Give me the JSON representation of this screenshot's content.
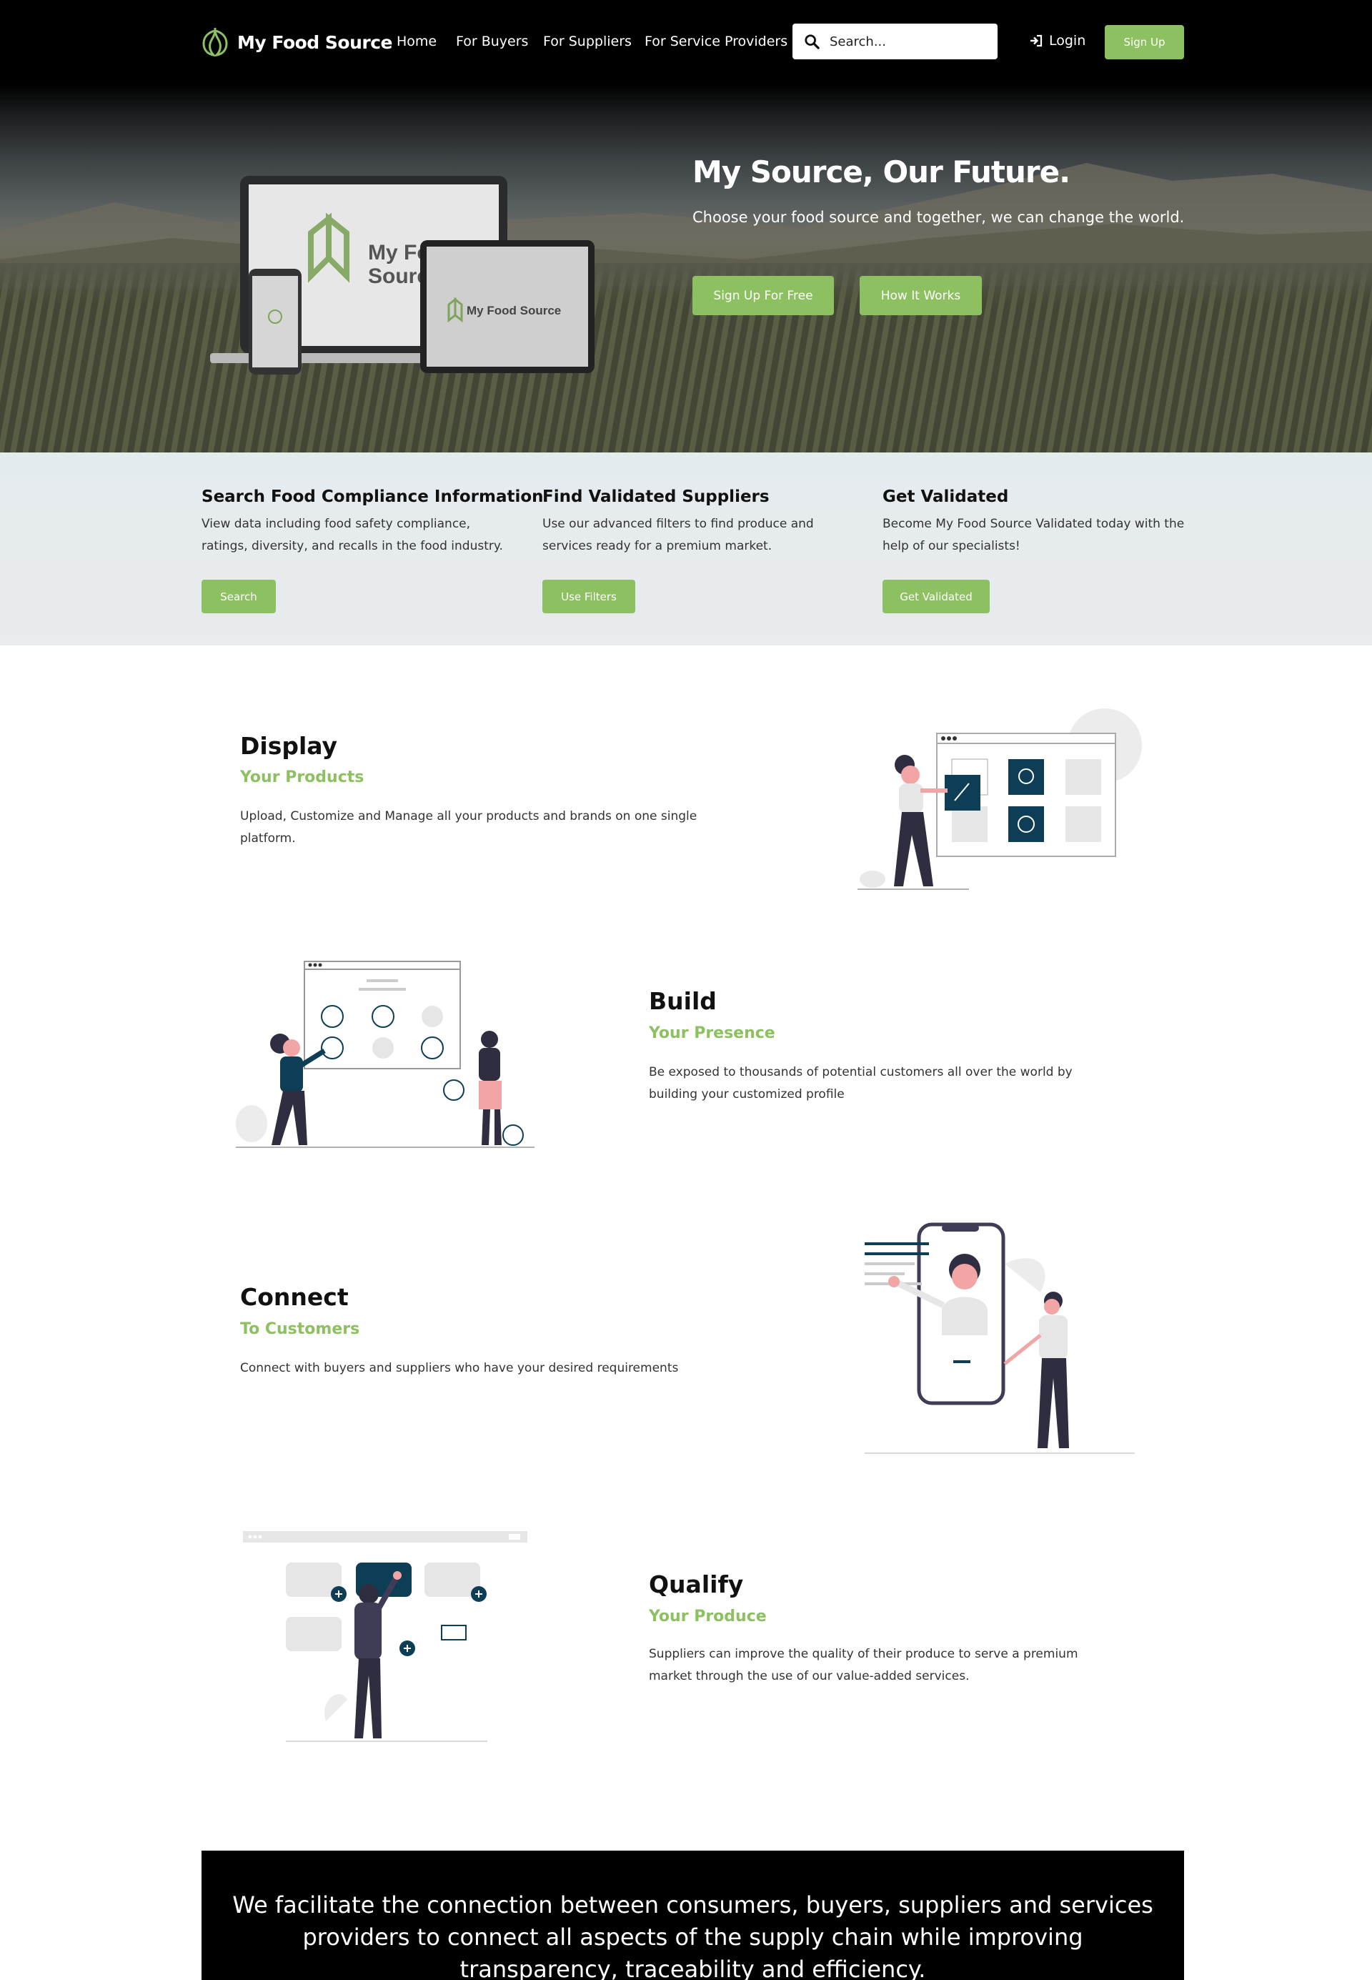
{
  "brand": {
    "name": "My Food Source",
    "accent": "#8cc060",
    "dark": "#0e3e55"
  },
  "nav": {
    "links": [
      "Home",
      "For Buyers",
      "For Suppliers",
      "For Service Providers"
    ],
    "search_placeholder": "Search...",
    "login_label": "Login",
    "signup_label": "Sign Up"
  },
  "hero": {
    "title": "My Source, Our Future.",
    "subtitle": "Choose your food source and together, we can change the world.",
    "primary_button": "Sign Up For Free",
    "secondary_button": "How It Works",
    "device_logo_line1": "My Food",
    "device_logo_line2": "Source"
  },
  "features": [
    {
      "title": "Search Food Compliance Information",
      "text": "View data including food safety compliance, ratings, diversity, and recalls in the food industry.",
      "button": "Search"
    },
    {
      "title": "Find Validated Suppliers",
      "text": "Use our advanced filters to find produce and services ready for a premium market.",
      "button": "Use Filters"
    },
    {
      "title": "Get Validated",
      "text": "Become My Food Source Validated today with the help of our specialists!",
      "button": "Get Validated"
    }
  ],
  "sections": [
    {
      "title": "Display",
      "subtitle": "Your Products",
      "text": "Upload, Customize and Manage all your products and brands on one single platform."
    },
    {
      "title": "Build",
      "subtitle": "Your Presence",
      "text": "Be exposed to thousands of potential customers all over the world by building your customized profile"
    },
    {
      "title": "Connect",
      "subtitle": "To Customers",
      "text": "Connect with buyers and suppliers who have your desired requirements"
    },
    {
      "title": "Qualify",
      "subtitle": "Your Produce",
      "text": "Suppliers can improve the quality of their produce to serve a premium market through the use of our value-added services."
    }
  ],
  "banner": {
    "text": "We facilitate the connection between consumers, buyers, suppliers and services providers to connect all aspects of the supply chain while improving transparency, traceability and efficiency."
  }
}
